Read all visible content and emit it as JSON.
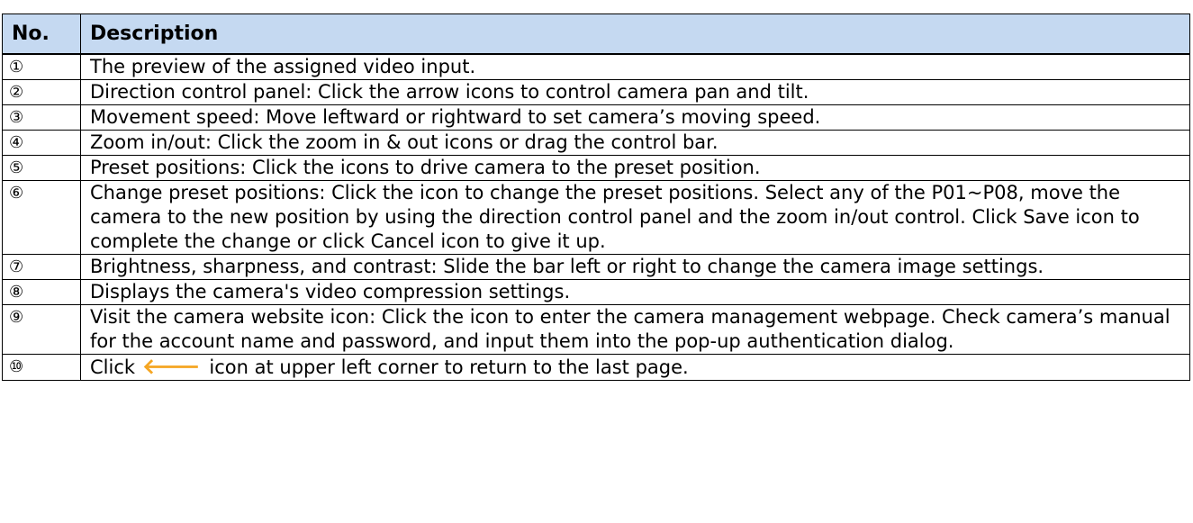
{
  "table": {
    "headers": [
      "No.",
      "Description"
    ],
    "rows": [
      {
        "no": "①",
        "desc": "The preview of the assigned video input."
      },
      {
        "no": "②",
        "desc": "Direction control panel: Click the arrow icons to control camera pan and tilt."
      },
      {
        "no": "③",
        "desc": "Movement speed: Move leftward or rightward to set camera’s moving speed."
      },
      {
        "no": "④",
        "desc": "Zoom in/out: Click the zoom in & out icons or drag the control bar."
      },
      {
        "no": "⑤",
        "desc": "Preset positions: Click the icons to drive camera to the preset position."
      },
      {
        "no": "⑥",
        "desc": "Change preset positions: Click the icon to change the preset positions. Select any of the P01~P08, move the camera to the new position by using the direction control panel and the zoom in/out control. Click Save icon to complete the change or click Cancel icon to give it up."
      },
      {
        "no": "⑦",
        "desc": "Brightness, sharpness, and contrast: Slide the bar left or right to change the camera image settings."
      },
      {
        "no": "⑧",
        "desc": "Displays the camera's video compression settings."
      },
      {
        "no": "⑨",
        "desc": "Visit the camera website icon: Click the icon to enter the camera management webpage. Check camera’s manual for the account name and password, and input them into the pop-up authentication dialog."
      },
      {
        "no": "⑩",
        "desc_before": "Click",
        "desc_after": "icon at upper left corner to return to the last page."
      }
    ]
  },
  "icons": {
    "back_arrow": {
      "name": "left-arrow-icon",
      "glyph": "🡐",
      "color": "#f5a623"
    }
  },
  "colors": {
    "header_bg": "#c5d9f1"
  }
}
